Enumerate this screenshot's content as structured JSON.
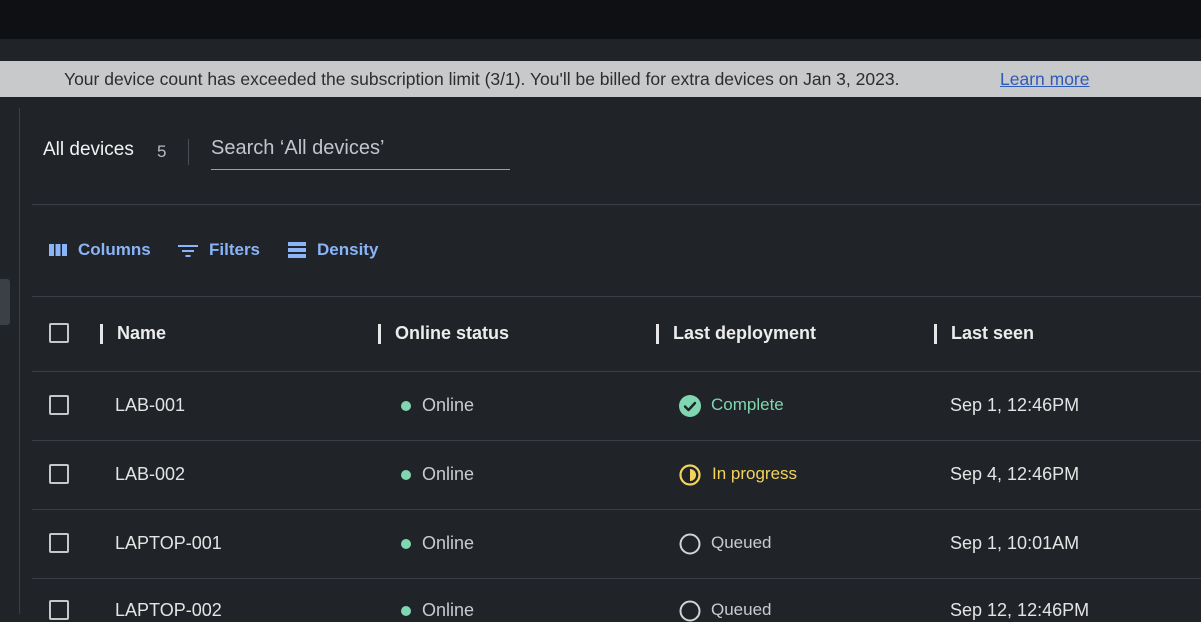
{
  "banner": {
    "message": "Your device count has exceeded the subscription limit (3/1). You'll be billed for extra devices on Jan 3, 2023.",
    "link": "Learn more"
  },
  "header": {
    "title": "All devices",
    "count": "5",
    "search_placeholder": "Search ‘All devices’"
  },
  "toolbar": {
    "columns": "Columns",
    "filters": "Filters",
    "density": "Density"
  },
  "table": {
    "columns": [
      "Name",
      "Online status",
      "Last deployment",
      "Last seen"
    ],
    "rows": [
      {
        "name": "LAB-001",
        "status": "Online",
        "deployment": "Complete",
        "deployment_state": "complete",
        "last_seen": "Sep 1, 12:46PM"
      },
      {
        "name": "LAB-002",
        "status": "Online",
        "deployment": "In progress",
        "deployment_state": "in-progress",
        "last_seen": "Sep 4, 12:46PM"
      },
      {
        "name": "LAPTOP-001",
        "status": "Online",
        "deployment": "Queued",
        "deployment_state": "queued",
        "last_seen": "Sep 1, 10:01AM"
      },
      {
        "name": "LAPTOP-002",
        "status": "Online",
        "deployment": "Queued",
        "deployment_state": "queued",
        "last_seen": "Sep 12, 12:46PM"
      }
    ]
  },
  "colors": {
    "accent": "#8ab4f8",
    "online": "#7fd6b1",
    "in_progress": "#f2d35c",
    "banner_bg": "#c8c9cb"
  },
  "icons": {
    "columns": "columns-icon",
    "filters": "filter-icon",
    "density": "density-icon",
    "complete": "check-circle-icon",
    "in_progress": "half-circle-icon",
    "queued": "empty-circle-icon"
  }
}
